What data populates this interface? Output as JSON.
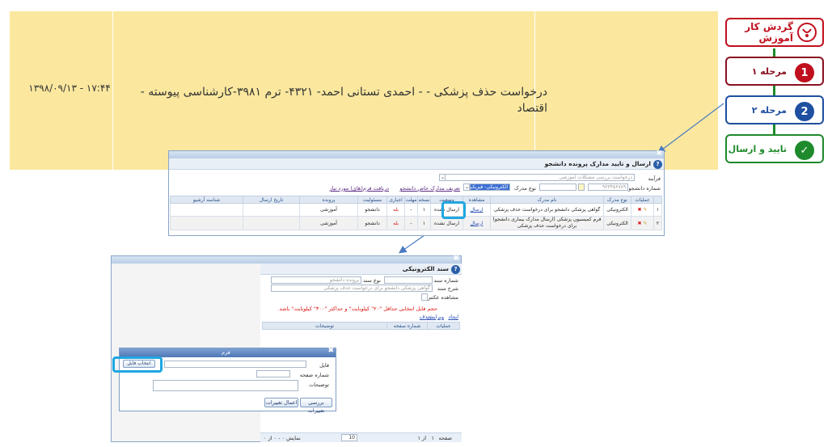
{
  "band": {
    "datetime": "۱۳۹۸/۰۹/۱۳ - ۱۷:۴۴",
    "title": "درخواست حذف پزشکی - - احمدی تستانی احمد- ۴۳۲۱- ترم ۳۹۸۱-کارشناسی پیوسته - اقتصاد"
  },
  "steps": {
    "header": "گردش کار آموزش",
    "items": [
      {
        "label": "مرحله ۱",
        "number": "1",
        "color": "#c0101e"
      },
      {
        "label": "مرحله ۲",
        "number": "2",
        "color": "#1e4fa0"
      },
      {
        "label": "تایید و ارسال",
        "number": "✓",
        "color": "#1e8a2c"
      }
    ]
  },
  "win1": {
    "title": "ارسال و تایید مدارک پرونده دانشجو",
    "farayand_label": "فرآیند",
    "farayand_value": "درخواست بررسی مشکلات آموزشی",
    "student_no_label": "شماره دانشجو",
    "student_no_value": "۹۲۳۴۵۶۷۸۹",
    "doc_type_label": "نوع مدرک",
    "doc_type_value": "الکترونیکی- فیزیکی",
    "link_define": "تعریف مدارک خاص دانشجو",
    "link_receive": "دریافت فرم(های) مورد نیاز",
    "columns": [
      "",
      "عملیات",
      "نوع مدرک",
      "نام مدرک",
      "مشاهده",
      "وضعیت",
      "نسخه",
      "مهلت",
      "اجباری",
      "مسئولیت",
      "پرونده",
      "تاریخ ارسال",
      "شناسه آرشیو"
    ],
    "rows": [
      {
        "idx": "۱",
        "type": "الکترونیکی",
        "name": "گواهی پزشکی دانشجو برای درخواست حذف پزشکی",
        "view": "ارسال",
        "status": "ارسال نشده",
        "copy": "۱",
        "deadline": "-",
        "mandatory": "بله",
        "resp": "دانشجو",
        "file": "آموزشی"
      },
      {
        "idx": "۲",
        "type": "الکترونیکی",
        "name": "فرم کمیسیون پزشکی (ارسال مدارک بیماری دانشجو) برای درخواست حذف پزشکی",
        "view": "ارسال",
        "status": "ارسال نشده",
        "copy": "۱",
        "deadline": "-",
        "mandatory": "بله",
        "resp": "دانشجو",
        "file": "آموزشی"
      }
    ]
  },
  "win2": {
    "title": "سند الکترونیکی",
    "doc_no_label": "شماره سند",
    "doc_type_label": "نوع سند",
    "doc_type_value": "پرونده دانشجو",
    "desc_label": "شرح سند",
    "desc_value": "گواهی پزشکی دانشجو برای درخواست حذف پزشکی",
    "view_image_label": "مشاهده عکس",
    "warning": "حجم فایل انتخابی حداقل \"۲۰\" کیلوبایت\" و حداکثر \"۳۰۰\" کیلوبایت\" باشد.",
    "link_new": "ایجاد",
    "link_edit": "ویرایش",
    "link_delete": "حذف",
    "columns": [
      "عملیات",
      "شماره صفحه",
      "توضیحات"
    ],
    "pager_page_label": "صفحه",
    "pager_page": "۱",
    "pager_of": "از ۱",
    "pager_size": "10",
    "pager_summary": "نمایش ۰ - ۰ از ۰"
  },
  "win3": {
    "title": "فرم",
    "file_label": "فایل",
    "choose_file": "انتخاب فایل",
    "page_no_label": "شماره صفحه",
    "notes_label": "توضیحات",
    "btn_review": "بررسی تغییرات",
    "btn_apply": "اعمال تغییرات"
  }
}
